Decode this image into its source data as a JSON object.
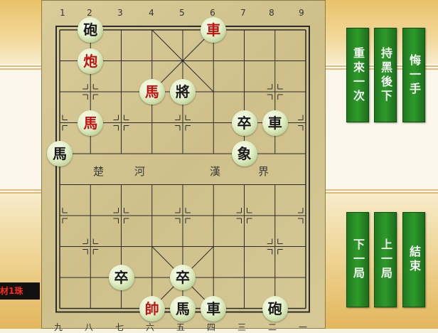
{
  "board": {
    "top_coords": [
      "1",
      "2",
      "3",
      "4",
      "5",
      "6",
      "7",
      "8",
      "9"
    ],
    "bottom_coords": [
      "九",
      "八",
      "七",
      "六",
      "五",
      "四",
      "三",
      "二",
      "一"
    ],
    "river_left": [
      "楚",
      "河"
    ],
    "river_right": [
      "漢",
      "界"
    ]
  },
  "pieces": [
    {
      "label": "砲",
      "side": "black",
      "col": 1,
      "row": 0
    },
    {
      "label": "車",
      "side": "red",
      "col": 5,
      "row": 0
    },
    {
      "label": "炮",
      "side": "red",
      "col": 1,
      "row": 1
    },
    {
      "label": "馬",
      "side": "red",
      "col": 3,
      "row": 2
    },
    {
      "label": "將",
      "side": "black",
      "col": 4,
      "row": 2
    },
    {
      "label": "馬",
      "side": "red",
      "col": 1,
      "row": 3
    },
    {
      "label": "卒",
      "side": "black",
      "col": 6,
      "row": 3
    },
    {
      "label": "車",
      "side": "black",
      "col": 7,
      "row": 3
    },
    {
      "label": "馬",
      "side": "black",
      "col": 0,
      "row": 4
    },
    {
      "label": "象",
      "side": "black",
      "col": 6,
      "row": 4
    },
    {
      "label": "卒",
      "side": "black",
      "col": 2,
      "row": 8
    },
    {
      "label": "卒",
      "side": "black",
      "col": 4,
      "row": 8
    },
    {
      "label": "帥",
      "side": "red",
      "col": 3,
      "row": 9
    },
    {
      "label": "馬",
      "side": "black",
      "col": 4,
      "row": 9
    },
    {
      "label": "車",
      "side": "black",
      "col": 5,
      "row": 9
    },
    {
      "label": "砲",
      "side": "black",
      "col": 7,
      "row": 9
    }
  ],
  "buttons": {
    "restart": "重來一次",
    "black_first": "持黑後下",
    "undo": "悔一手",
    "next": "下一局",
    "prev": "上一局",
    "end": "結束"
  },
  "status": {
    "text": "材1珠"
  },
  "colors": {
    "red_piece": "#c0130f",
    "black_piece": "#1a1a1a",
    "button_green": "#2f9a2a",
    "board": "#d3c590"
  }
}
